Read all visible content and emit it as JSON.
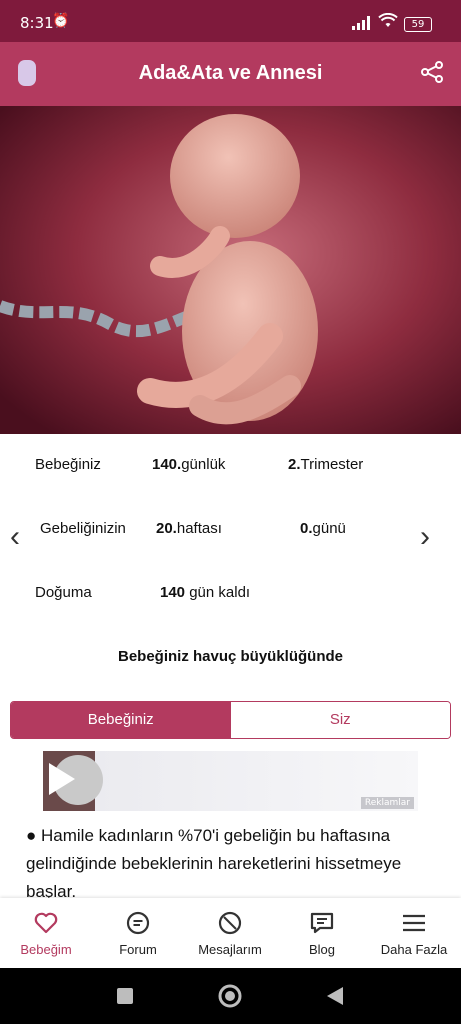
{
  "status": {
    "time": "8:31",
    "battery": "59"
  },
  "appbar": {
    "title": "Ada&Ata ve Annesi",
    "logo_icon": "baby-bottle-icon",
    "share_icon": "share-icon"
  },
  "hero": {
    "image_icon": "fetus-image"
  },
  "info": {
    "row1": {
      "label": "Bebeğiniz",
      "days": "140.",
      "days_unit": "günlük",
      "trimester": "2.",
      "trimester_unit": "Trimester"
    },
    "row2": {
      "label": "Gebeliğinizin",
      "week": "20.",
      "week_unit": "haftası",
      "day": "0.",
      "day_unit": "günü"
    },
    "row3": {
      "label": "Doğuma",
      "value": "140",
      "value_unit": "gün kaldı"
    },
    "size_text": "Bebeğiniz havuç büyüklüğünde"
  },
  "tabs": {
    "active": "Bebeğiniz",
    "inactive": "Siz"
  },
  "ad": {
    "label": "Reklamlar"
  },
  "fact": "● Hamile kadınların %70'i gebeliğin bu haftasına gelindiğinde bebeklerinin hareketlerini hissetmeye başlar.",
  "bottomnav": {
    "items": [
      {
        "label": "Bebeğim",
        "icon": "heart-icon"
      },
      {
        "label": "Forum",
        "icon": "chat-icon"
      },
      {
        "label": "Mesajlarım",
        "icon": "messages-icon"
      },
      {
        "label": "Blog",
        "icon": "blog-icon"
      },
      {
        "label": "Daha Fazla",
        "icon": "menu-icon"
      }
    ]
  },
  "colors": {
    "primary": "#b33a5f",
    "status_bar": "#7f1a3c"
  }
}
